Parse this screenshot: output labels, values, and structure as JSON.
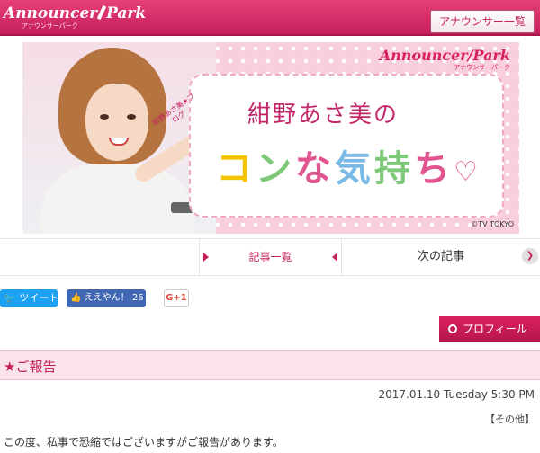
{
  "header": {
    "logo_main": "Announcer",
    "logo_main2": "Park",
    "logo_sub": "アナウンサーパーク",
    "list_button": "アナウンサー一覧"
  },
  "banner": {
    "logo_main": "Announcer",
    "logo_main2": "Park",
    "logo_sub": "アナウンサーパーク",
    "tag": "紺野あさ美★ブログ",
    "name": "紺野あさ美の",
    "title_parts": [
      "コ",
      "ン",
      "な",
      "気",
      "持",
      "ち"
    ],
    "heart": "♡",
    "copyright": "©TV TOKYO"
  },
  "nav": {
    "list_label": "記事一覧",
    "next_label": "次の記事",
    "next_arrow": "❯"
  },
  "social": {
    "tweet": "ツイート",
    "like": "ええやん！",
    "like_count": "26",
    "gplus": "G+1"
  },
  "profile_button": "プロフィール",
  "article": {
    "title": "★ご報告",
    "date": "2017.01.10 Tuesday 5:30 PM",
    "category": "【その他】",
    "first_line": "この度、私事で恐縮ではございますがご報告があります。"
  },
  "colors": {
    "brand": "#c41e5b",
    "section_bg": "#fbe3eb",
    "twitter": "#1da1f2",
    "facebook": "#4267b2"
  }
}
